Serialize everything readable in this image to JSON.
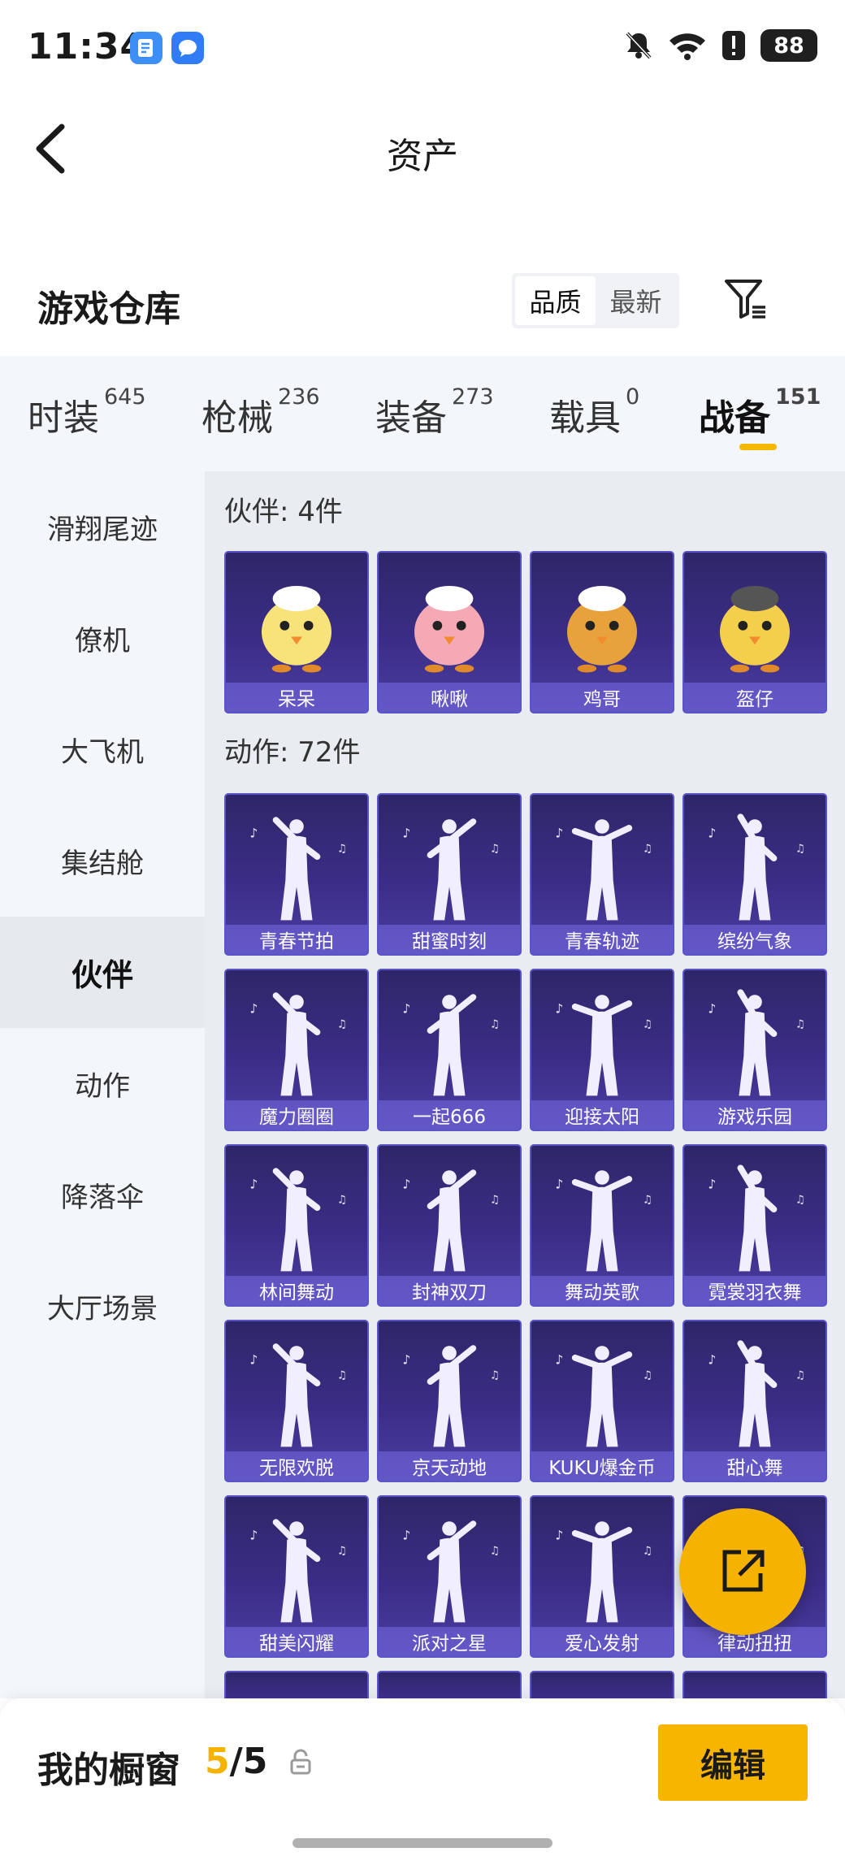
{
  "status_bar": {
    "time": "11:34",
    "battery": "88"
  },
  "header": {
    "title": "资产"
  },
  "section": {
    "title": "游戏仓库",
    "sort_options": [
      "品质",
      "最新"
    ]
  },
  "tabs": [
    {
      "label": "时装",
      "count": "645"
    },
    {
      "label": "枪械",
      "count": "236"
    },
    {
      "label": "装备",
      "count": "273"
    },
    {
      "label": "载具",
      "count": "0"
    },
    {
      "label": "战备",
      "count": "151"
    }
  ],
  "sidebar": [
    "滑翔尾迹",
    "僚机",
    "大飞机",
    "集结舱",
    "伙伴",
    "动作",
    "降落伞",
    "大厅场景"
  ],
  "groups": {
    "partners": {
      "title": "伙伴: 4件",
      "items": [
        "呆呆",
        "啾啾",
        "鸡哥",
        "盔仔"
      ]
    },
    "actions": {
      "title": "动作: 72件",
      "items": [
        "青春节拍",
        "甜蜜时刻",
        "青春轨迹",
        "缤纷气象",
        "魔力圈圈",
        "一起666",
        "迎接太阳",
        "游戏乐园",
        "林间舞动",
        "封神双刀",
        "舞动英歌",
        "霓裳羽衣舞",
        "无限欢脱",
        "京天动地",
        "KUKU爆金币",
        "甜心舞",
        "甜美闪耀",
        "派对之星",
        "爱心发射",
        "律动扭扭"
      ]
    }
  },
  "bottom_bar": {
    "label": "我的橱窗",
    "current": "5",
    "separator": "/",
    "total": "5",
    "edit": "编辑"
  }
}
